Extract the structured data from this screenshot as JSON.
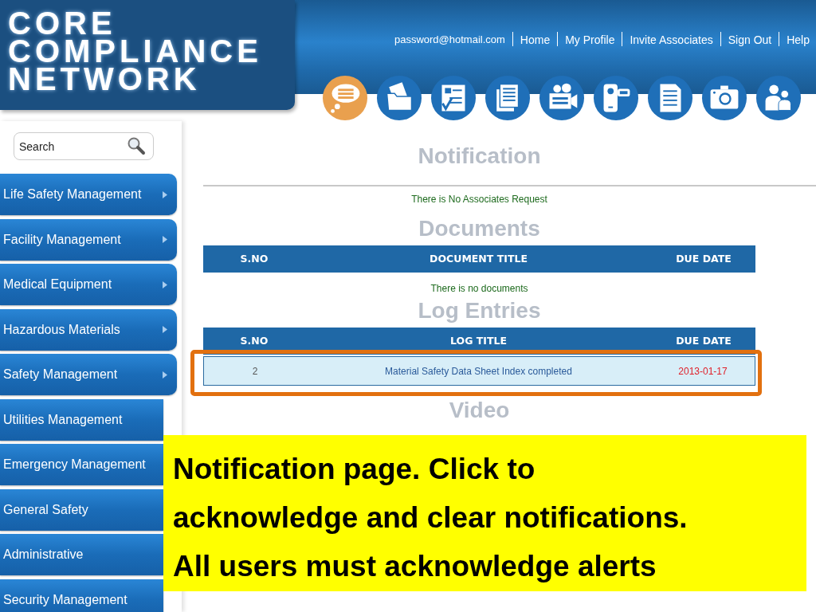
{
  "logo": {
    "lines": [
      "CORE",
      "COMPLIANCE",
      "NETWORK"
    ]
  },
  "account_email": "password@hotmail.com",
  "nav_links": [
    "Home",
    "My Profile",
    "Invite Associates",
    "Sign Out",
    "Help"
  ],
  "toolbar": [
    {
      "kind": "chat",
      "selected": true
    },
    {
      "kind": "folder",
      "selected": false
    },
    {
      "kind": "checklist",
      "selected": false
    },
    {
      "kind": "pages",
      "selected": false
    },
    {
      "kind": "movie",
      "selected": false
    },
    {
      "kind": "camcorder",
      "selected": false
    },
    {
      "kind": "document",
      "selected": false
    },
    {
      "kind": "camera",
      "selected": false
    },
    {
      "kind": "people",
      "selected": false
    }
  ],
  "search": {
    "placeholder": "Search"
  },
  "sidebar": {
    "items": [
      "Life Safety Management",
      "Facility Management",
      "Medical Equipment",
      "Hazardous Materials",
      "Safety Management",
      "Utilities Management",
      "Emergency Management",
      "General Safety",
      "Administrative",
      "Security Management"
    ]
  },
  "notification": {
    "title": "Notification",
    "message": "There is No Associates Request"
  },
  "documents": {
    "title": "Documents",
    "columns": [
      "S.NO",
      "DOCUMENT TITLE",
      "DUE DATE"
    ],
    "empty_message": "There is no documents"
  },
  "log_entries": {
    "title": "Log Entries",
    "columns": [
      "S.NO",
      "LOG TITLE",
      "DUE DATE"
    ],
    "rows": [
      {
        "cells": [
          "2",
          "Material Safety Data Sheet Index completed",
          "2013-01-17"
        ],
        "highlighted": true
      }
    ]
  },
  "video": {
    "title": "Video"
  },
  "callout": {
    "lines": [
      "Notification page. Click to",
      "acknowledge and clear notifications.",
      "All users must acknowledge alerts"
    ]
  }
}
